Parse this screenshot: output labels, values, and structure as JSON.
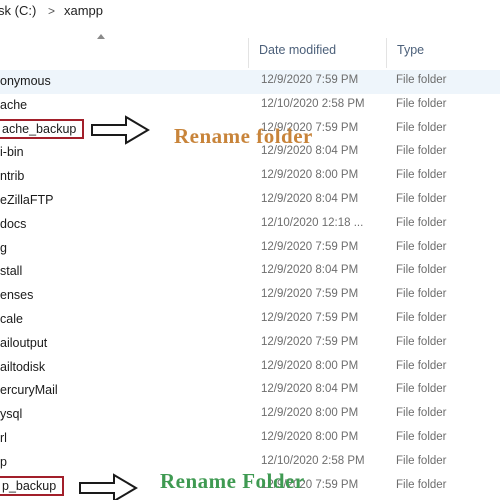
{
  "breadcrumb": {
    "drive_label": "sk (C:)",
    "separator": ">",
    "folder_label": "xampp"
  },
  "columns": {
    "date_modified": "Date modified",
    "type": "Type"
  },
  "rows": [
    {
      "name": "onymous",
      "date": "12/9/2020 7:59 PM",
      "type": "File folder"
    },
    {
      "name": "ache",
      "date": "12/10/2020 2:58 PM",
      "type": "File folder"
    },
    {
      "name": "ache_backup",
      "date": "12/9/2020 7:59 PM",
      "type": "File folder"
    },
    {
      "name": "i-bin",
      "date": "12/9/2020 8:04 PM",
      "type": "File folder"
    },
    {
      "name": "ntrib",
      "date": "12/9/2020 8:00 PM",
      "type": "File folder"
    },
    {
      "name": "eZillaFTP",
      "date": "12/9/2020 8:04 PM",
      "type": "File folder"
    },
    {
      "name": "docs",
      "date": "12/10/2020 12:18 ...",
      "type": "File folder"
    },
    {
      "name": "g",
      "date": "12/9/2020 7:59 PM",
      "type": "File folder"
    },
    {
      "name": "stall",
      "date": "12/9/2020 8:04 PM",
      "type": "File folder"
    },
    {
      "name": "enses",
      "date": "12/9/2020 7:59 PM",
      "type": "File folder"
    },
    {
      "name": "cale",
      "date": "12/9/2020 7:59 PM",
      "type": "File folder"
    },
    {
      "name": "ailoutput",
      "date": "12/9/2020 7:59 PM",
      "type": "File folder"
    },
    {
      "name": "ailtodisk",
      "date": "12/9/2020 8:00 PM",
      "type": "File folder"
    },
    {
      "name": "ercuryMail",
      "date": "12/9/2020 8:04 PM",
      "type": "File folder"
    },
    {
      "name": "ysql",
      "date": "12/9/2020 8:00 PM",
      "type": "File folder"
    },
    {
      "name": "rl",
      "date": "12/9/2020 8:00 PM",
      "type": "File folder"
    },
    {
      "name": "p",
      "date": "12/10/2020 2:58 PM",
      "type": "File folder"
    },
    {
      "name": "p_backup",
      "date": "12/9/2020 7:59 PM",
      "type": "File folder"
    }
  ],
  "annotations": [
    {
      "text": "Rename folder",
      "color": "#c8843a"
    },
    {
      "text": "Rename Folder",
      "color": "#3f9a52"
    }
  ],
  "colors": {
    "highlight_box": "#a21f2a",
    "selected_row": "#eef5fb",
    "header_text": "#4c607a"
  }
}
